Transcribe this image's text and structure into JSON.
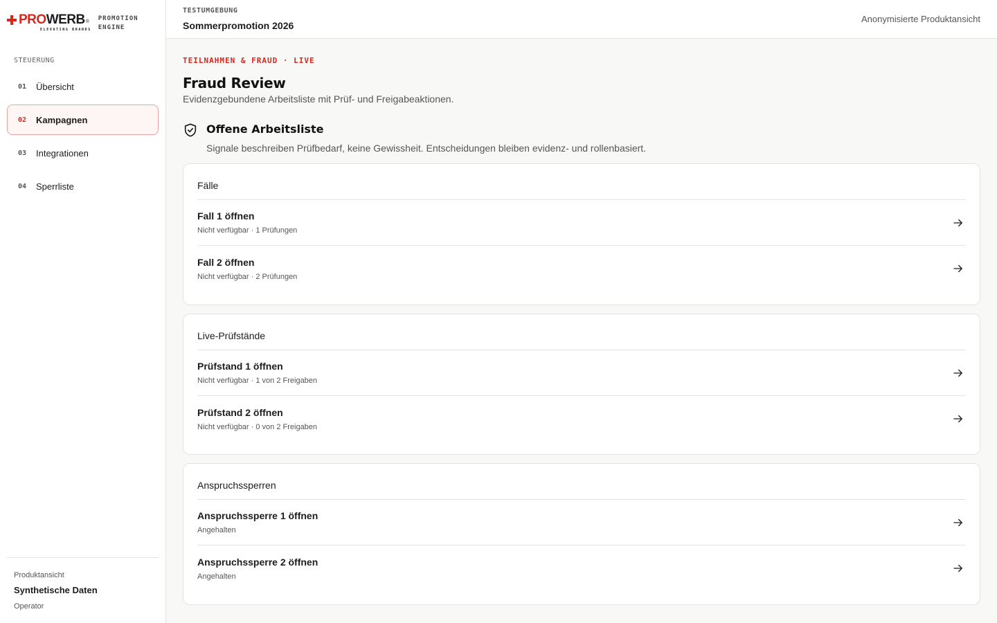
{
  "brand": {
    "logo_red": "PRO",
    "logo_dark": "WERB",
    "logo_reg": "®",
    "logo_tagline": "ELEVATING BRANDS",
    "product_line1": "PROMOTION",
    "product_line2": "ENGINE"
  },
  "sidebar": {
    "section_label": "STEUERUNG",
    "items": [
      {
        "num": "01",
        "label": "Übersicht",
        "active": false
      },
      {
        "num": "02",
        "label": "Kampagnen",
        "active": true
      },
      {
        "num": "03",
        "label": "Integrationen",
        "active": false
      },
      {
        "num": "04",
        "label": "Sperrliste",
        "active": false
      }
    ],
    "footer": {
      "label": "Produktansicht",
      "value": "Synthetische Daten",
      "role": "Operator"
    }
  },
  "header": {
    "environment": "TESTUMGEBUNG",
    "campaign": "Sommerpromotion 2026",
    "view_mode": "Anonymisierte Produktansicht"
  },
  "main": {
    "eyebrow": "TEILNAHMEN & FRAUD · LIVE",
    "title": "Fraud Review",
    "subtitle": "Evidenzgebundene Arbeitsliste mit Prüf- und Freigabeaktionen.",
    "section": {
      "icon": "shield-check-icon",
      "title": "Offene Arbeitsliste",
      "subtitle": "Signale beschreiben Prüfbedarf, keine Gewissheit. Entscheidungen bleiben evidenz- und rollenbasiert."
    },
    "cards": [
      {
        "heading": "Fälle",
        "rows": [
          {
            "title": "Fall 1 öffnen",
            "meta": "Nicht verfügbar · 1 Prüfungen"
          },
          {
            "title": "Fall 2 öffnen",
            "meta": "Nicht verfügbar · 2 Prüfungen"
          }
        ]
      },
      {
        "heading": "Live-Prüfstände",
        "rows": [
          {
            "title": "Prüfstand 1 öffnen",
            "meta": "Nicht verfügbar · 1 von 2 Freigaben"
          },
          {
            "title": "Prüfstand 2 öffnen",
            "meta": "Nicht verfügbar · 0 von 2 Freigaben"
          }
        ]
      },
      {
        "heading": "Anspruchssperren",
        "rows": [
          {
            "title": "Anspruchssperre 1 öffnen",
            "meta": "Angehalten"
          },
          {
            "title": "Anspruchssperre 2 öffnen",
            "meta": "Angehalten"
          }
        ]
      }
    ]
  },
  "colors": {
    "accent": "#d9261c",
    "active_bg": "#fdf6f5",
    "active_border": "#e9a29c",
    "page_bg": "#f8f8f6"
  }
}
